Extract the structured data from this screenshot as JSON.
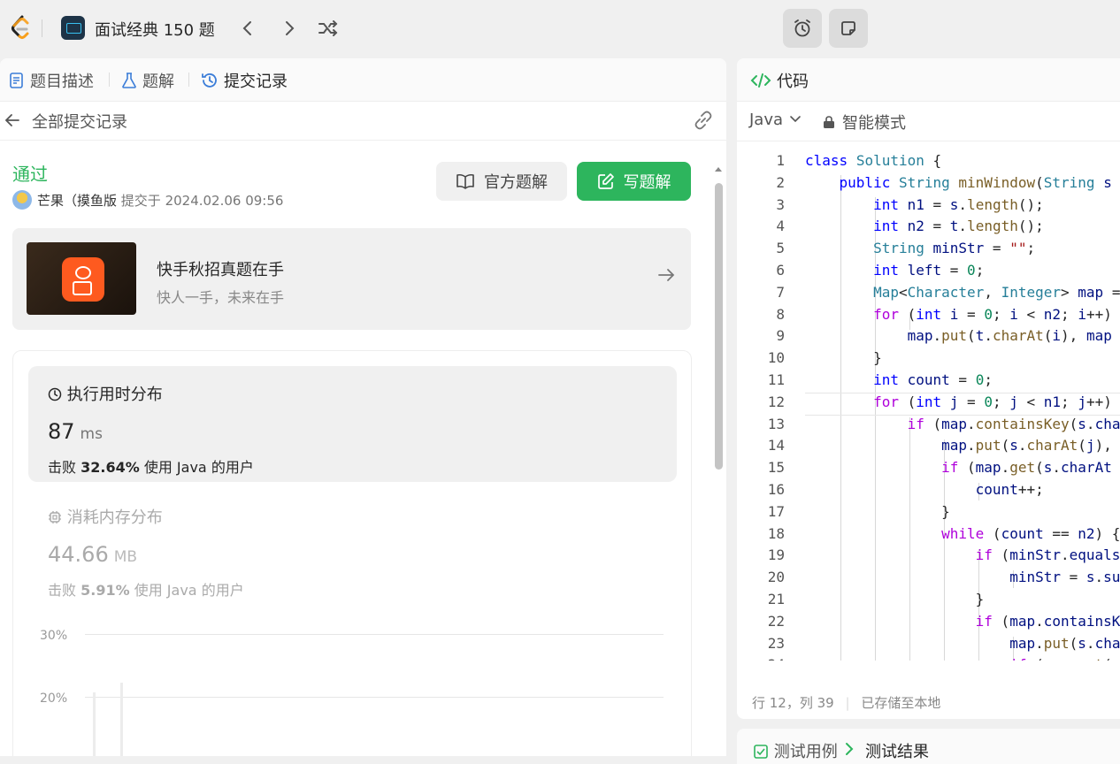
{
  "topbar": {
    "question_list_title": "面试经典 150 题",
    "prev_icon": "chevron-left-icon",
    "next_icon": "chevron-right-icon",
    "shuffle_icon": "shuffle-icon",
    "timer_icon": "alarm-clock-icon",
    "note_icon": "note-icon"
  },
  "left_tabs": [
    {
      "label": "题目描述",
      "icon": "description-icon"
    },
    {
      "label": "题解",
      "icon": "flask-icon"
    },
    {
      "label": "提交记录",
      "icon": "history-icon"
    }
  ],
  "submission": {
    "back_label": "全部提交记录",
    "status": "通过",
    "status_color": "#2db55d",
    "user": "芒果（摸鱼版",
    "submitted_at": "提交于 2024.02.06 09:56",
    "official_solution_btn": "官方题解",
    "write_solution_btn": "写题解"
  },
  "banner": {
    "title": "快手秋招真题在手",
    "subtitle": "快人一手，未来在手"
  },
  "runtime": {
    "title": "执行用时分布",
    "value": "87",
    "unit": "ms",
    "beat_prefix": "击败",
    "beat_pct": "32.64%",
    "beat_suffix": "使用 Java 的用户"
  },
  "memory": {
    "title": "消耗内存分布",
    "value": "44.66",
    "unit": "MB",
    "beat_prefix": "击败",
    "beat_pct": "5.91%",
    "beat_suffix": "使用 Java 的用户"
  },
  "chart_data": {
    "type": "bar",
    "y_ticks": [
      "30%",
      "20%"
    ]
  },
  "code_panel": {
    "title": "代码",
    "language": "Java",
    "mode": "智能模式",
    "status": "行 12，列 39",
    "saved": "已存储至本地"
  },
  "code_lines": [
    "class Solution {",
    "    public String minWindow(String s",
    "        int n1 = s.length();",
    "        int n2 = t.length();",
    "        String minStr = \"\";",
    "        int left = 0;",
    "        Map<Character, Integer> map =",
    "        for (int i = 0; i < n2; i++)",
    "            map.put(t.charAt(i), map",
    "        }",
    "        int count = 0;",
    "        for (int j = 0; j < n1; j++)",
    "            if (map.containsKey(s.cha",
    "                map.put(s.charAt(j),",
    "                if (map.get(s.charAt",
    "                    count++;",
    "                }",
    "                while (count == n2) {",
    "                    if (minStr.equals",
    "                        minStr = s.su",
    "                    }",
    "                    if (map.containsK",
    "                        map.put(s.cha",
    "                        if (map.get(s"
  ],
  "bottom_panel": {
    "testcase": "测试用例",
    "result": "测试结果"
  }
}
